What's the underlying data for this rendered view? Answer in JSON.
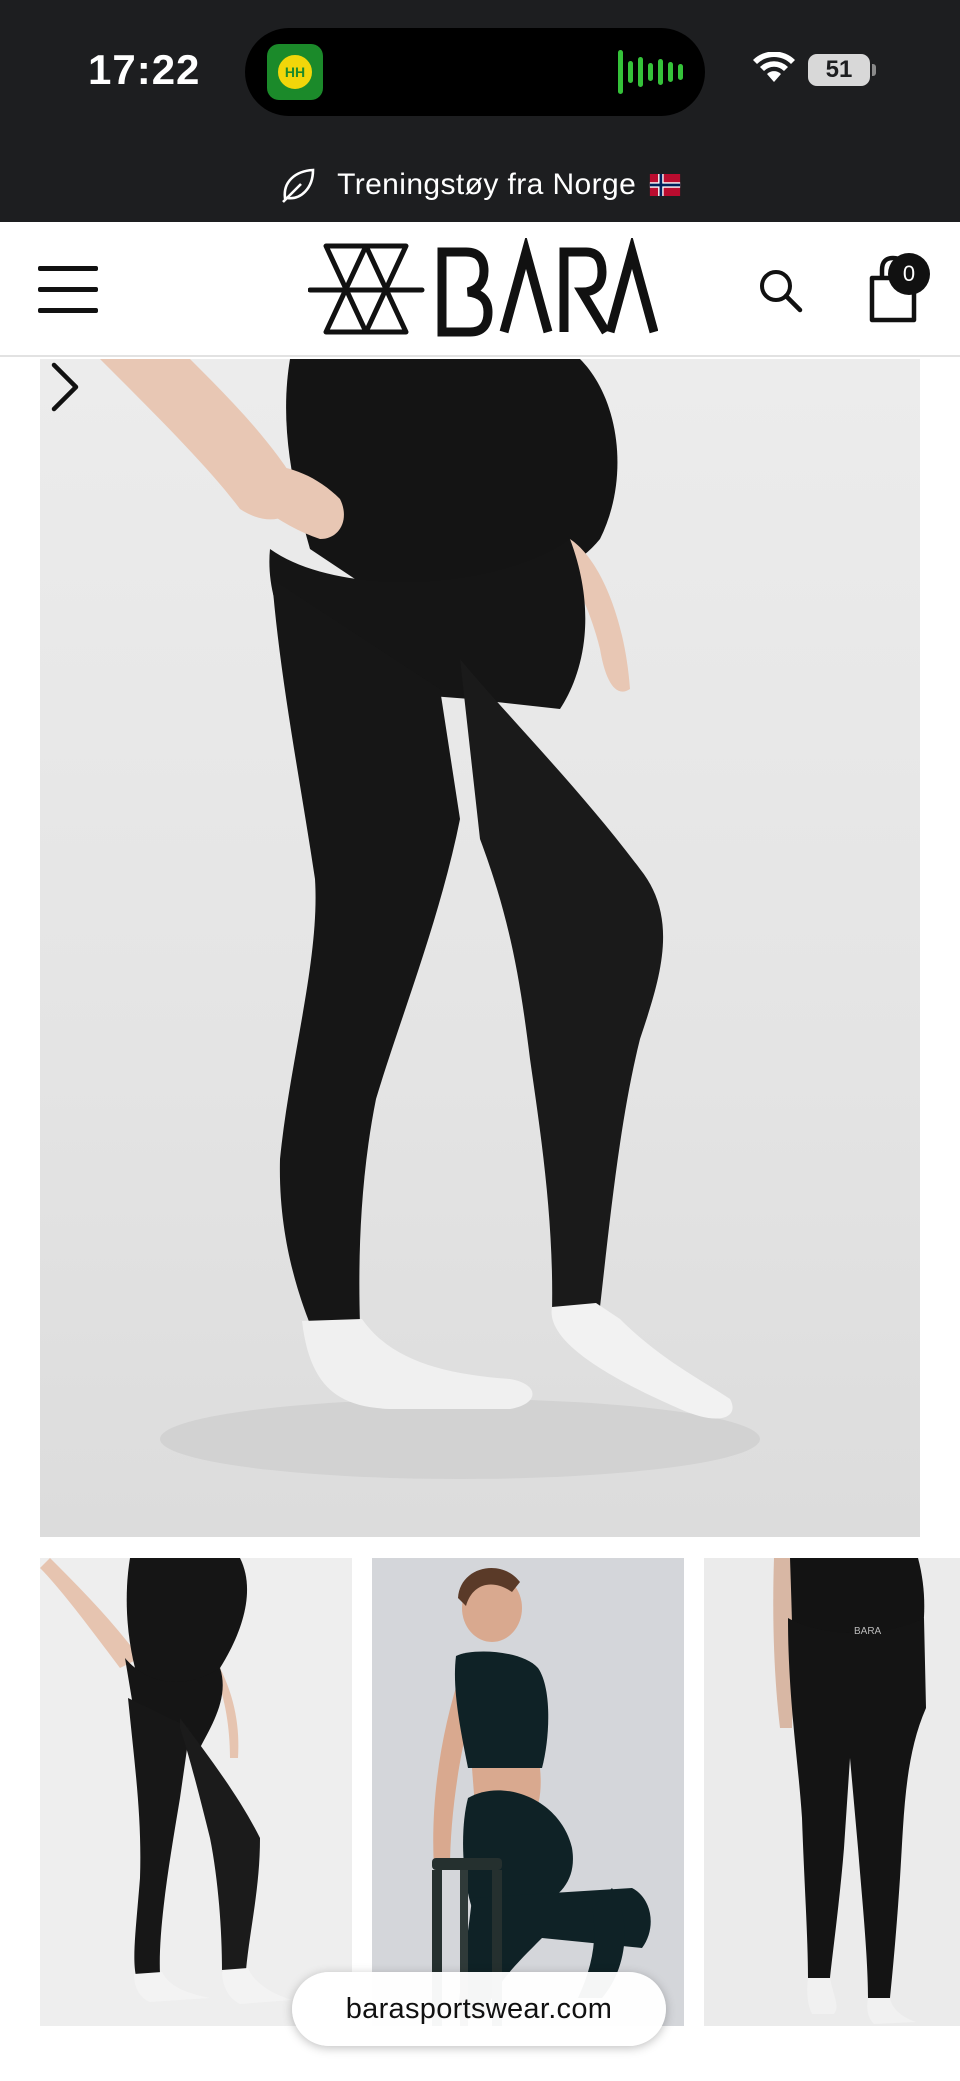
{
  "status_bar": {
    "time": "17:22",
    "battery": "51",
    "app_badge_text": "HH",
    "icons": [
      "wifi-icon",
      "battery-icon",
      "audio-activity-icon"
    ]
  },
  "promo": {
    "text": "Treningstøy fra Norge",
    "icon": "leaf-icon",
    "flag": "norway-flag-icon"
  },
  "header": {
    "logo_text": "BARA",
    "menu_icon": "hamburger-menu-icon",
    "search_icon": "search-icon",
    "cart_icon": "shopping-bag-icon",
    "cart_count": "0"
  },
  "gallery": {
    "main_image": "maternity leggings front side view",
    "next_icon": "chevron-right-icon",
    "thumbnails": [
      {
        "alt": "leggings side view"
      },
      {
        "alt": "model seated in sports bra and leggings"
      },
      {
        "alt": "leggings back view"
      }
    ]
  },
  "browser": {
    "url": "barasportswear.com"
  },
  "colors": {
    "dark_bar": "#1d1e20",
    "accent_green": "#35c23a",
    "text_dark": "#111111"
  }
}
